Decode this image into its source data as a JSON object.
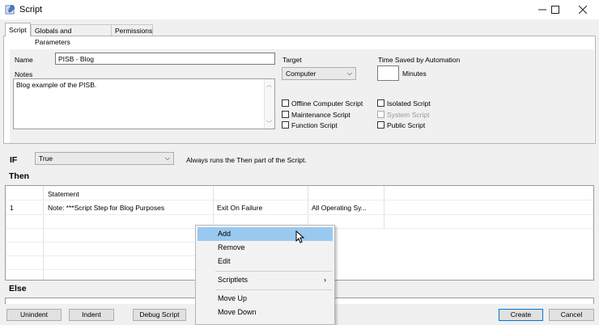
{
  "window": {
    "title": "Script",
    "minimize_icon": "minimize-icon",
    "maximize_icon": "maximize-icon",
    "close_icon": "close-icon"
  },
  "tabs": [
    {
      "label": "Script",
      "active": true
    },
    {
      "label": "Globals and Parameters",
      "active": false
    },
    {
      "label": "Permissions",
      "active": false
    }
  ],
  "form": {
    "name_label": "Name",
    "name_value": "PISB - Blog",
    "notes_label": "Notes",
    "notes_value": "Blog example of the PISB.",
    "target_label": "Target",
    "target_value": "Computer",
    "time_saved_label": "Time Saved by Automation",
    "time_saved_value": "",
    "minutes_label": "Minutes",
    "checkboxes": {
      "offline": "Offline Computer Script",
      "maintenance": "Maintenance Script",
      "function": "Function Script",
      "isolated": "Isolated Script",
      "system": "System Script",
      "public": "Public Script"
    }
  },
  "if_section": {
    "label": "IF",
    "condition_value": "True",
    "description": "Always runs the Then part of the Script."
  },
  "then_section": {
    "label": "Then",
    "columns": [
      "Statement"
    ],
    "rows": [
      {
        "num": "1",
        "statement": "Note: ***Script Step for Blog Purposes",
        "on_failure": "Exit On Failure",
        "os": "All Operating Sy..."
      }
    ]
  },
  "else_section": {
    "label": "Else"
  },
  "context_menu": {
    "items": [
      "Add",
      "Remove",
      "Edit",
      "Scriptlets",
      "Move Up",
      "Move Down"
    ],
    "highlighted": "Add"
  },
  "buttons": {
    "unindent": "Unindent",
    "indent": "Indent",
    "debug": "Debug Script",
    "create": "Create",
    "cancel": "Cancel"
  }
}
